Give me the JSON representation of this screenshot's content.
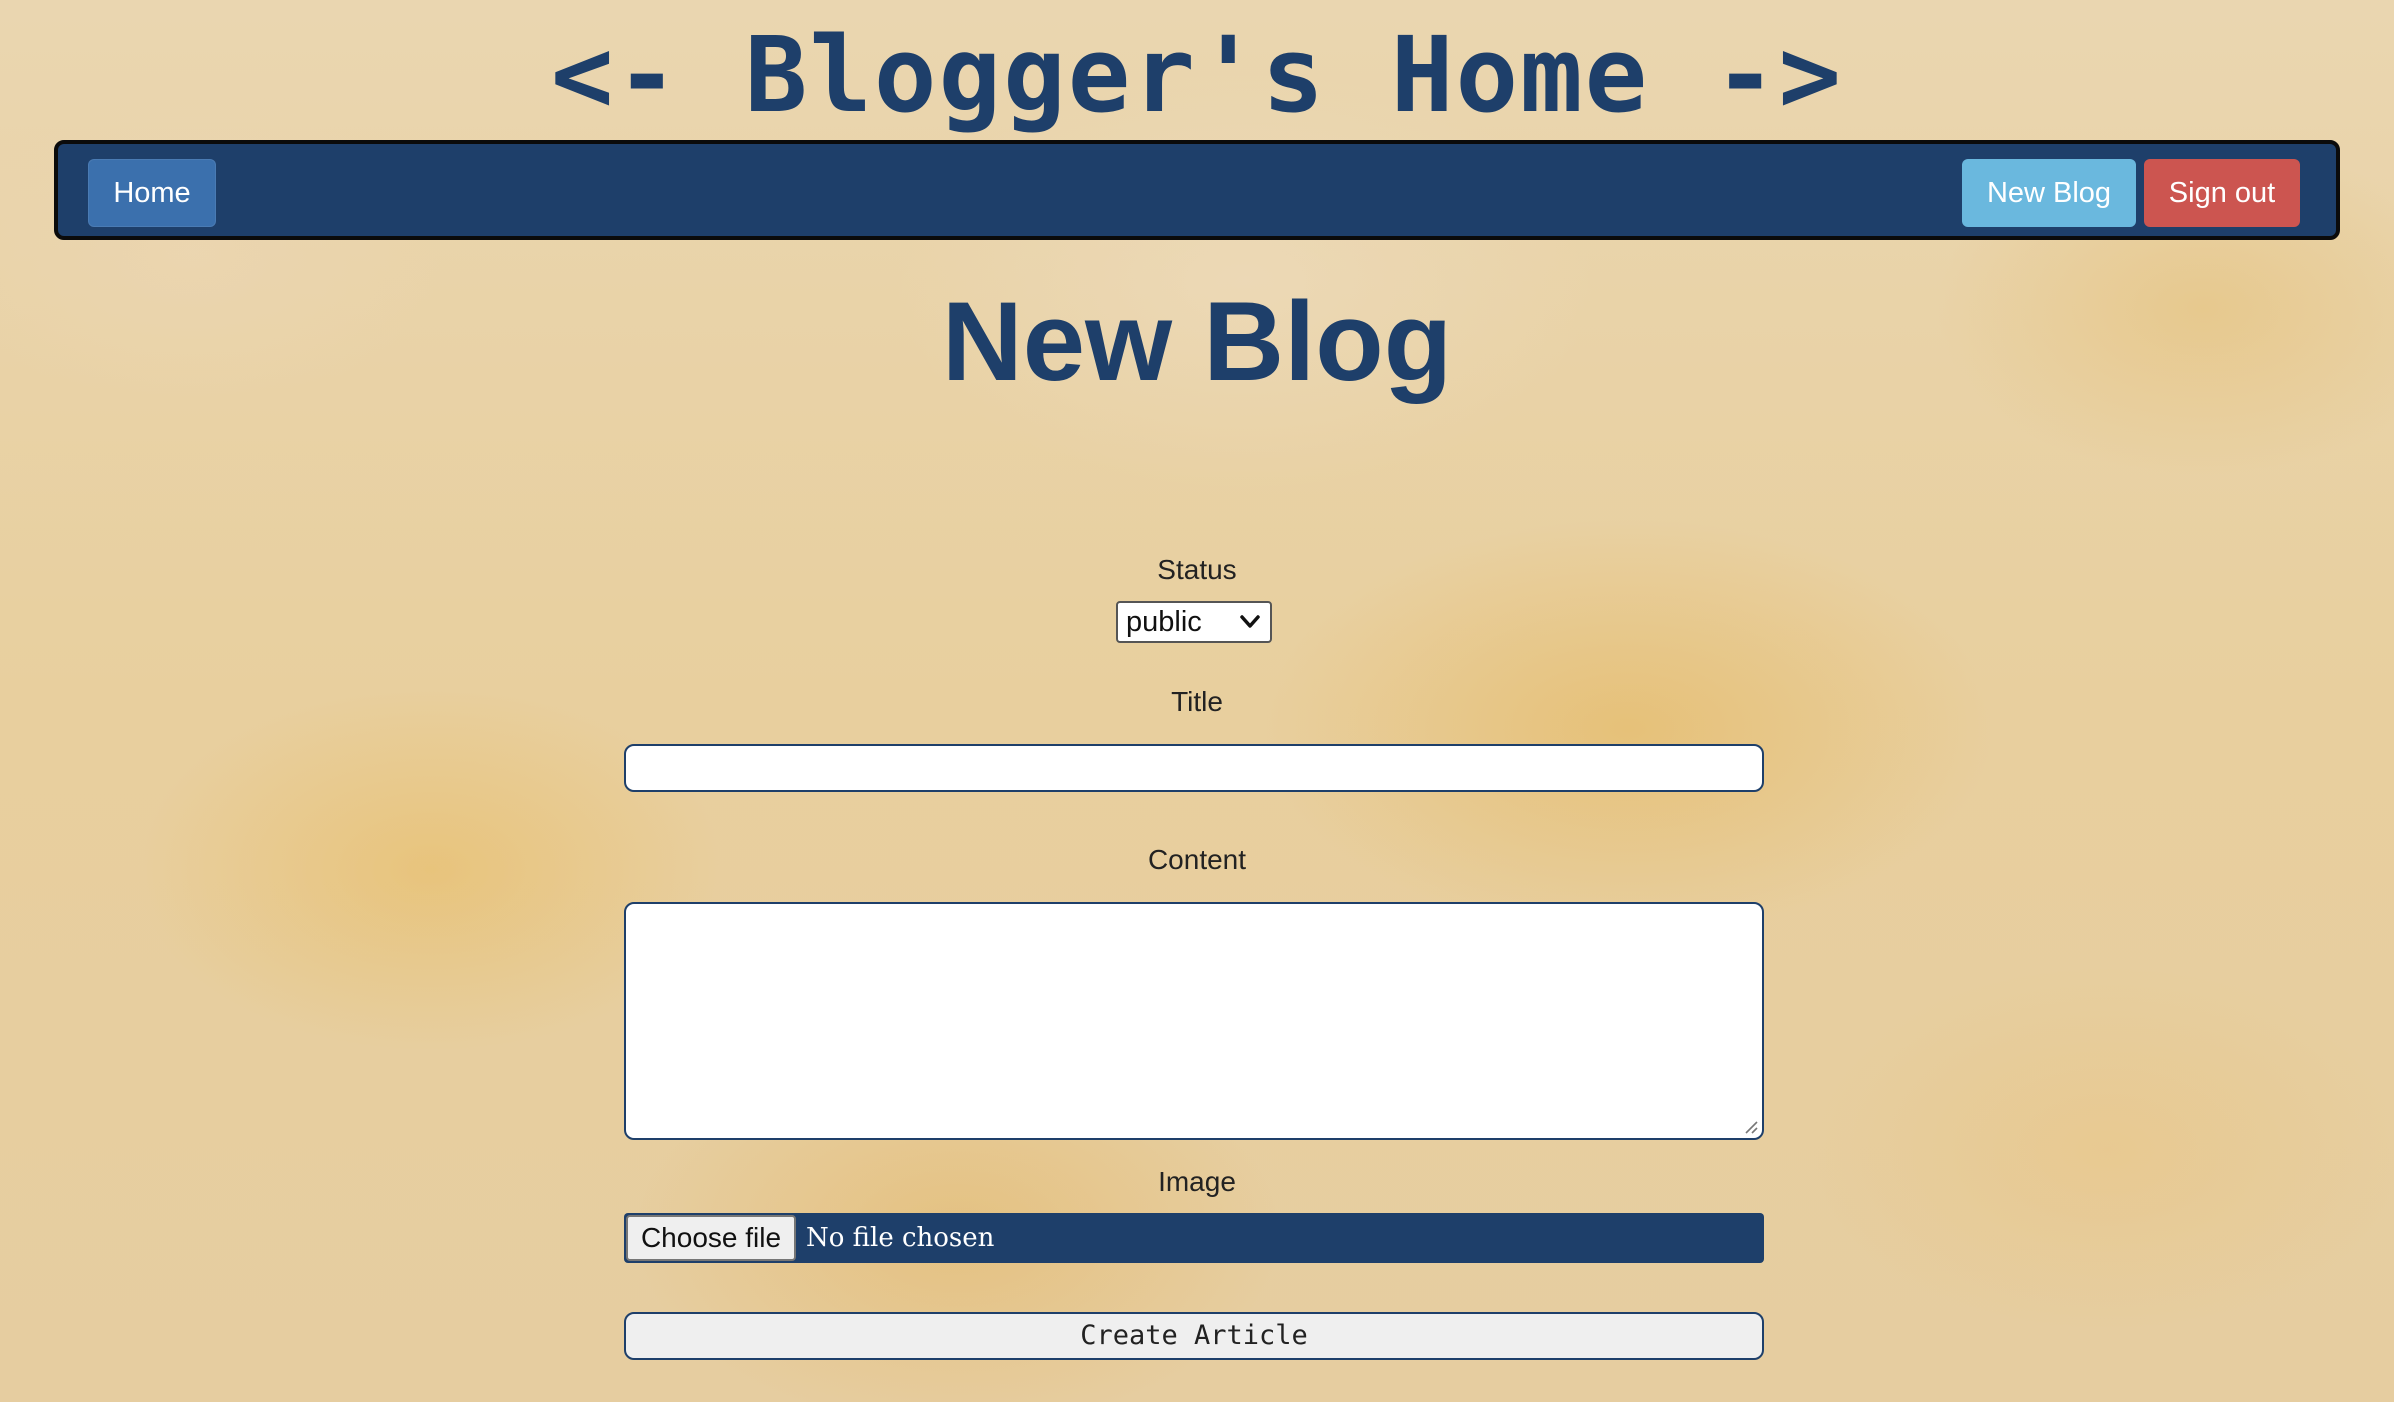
{
  "header": {
    "site_title": "<- Blogger's Home ->"
  },
  "nav": {
    "home_label": "Home",
    "new_blog_label": "New Blog",
    "sign_out_label": "Sign out"
  },
  "page": {
    "title": "New Blog"
  },
  "form": {
    "status": {
      "label": "Status",
      "selected": "public"
    },
    "title": {
      "label": "Title",
      "value": ""
    },
    "content": {
      "label": "Content",
      "value": ""
    },
    "image": {
      "label": "Image",
      "button_label": "Choose file",
      "status_text": "No file chosen"
    },
    "submit_label": "Create Article"
  },
  "colors": {
    "brand_navy": "#1e3f6a",
    "home_button": "#3b70ad",
    "new_blog_button": "#6ab8de",
    "sign_out_button": "#cc5550"
  },
  "icons": {
    "select_arrow": "chevron-down-icon",
    "textarea_resize": "resize-handle-icon"
  }
}
